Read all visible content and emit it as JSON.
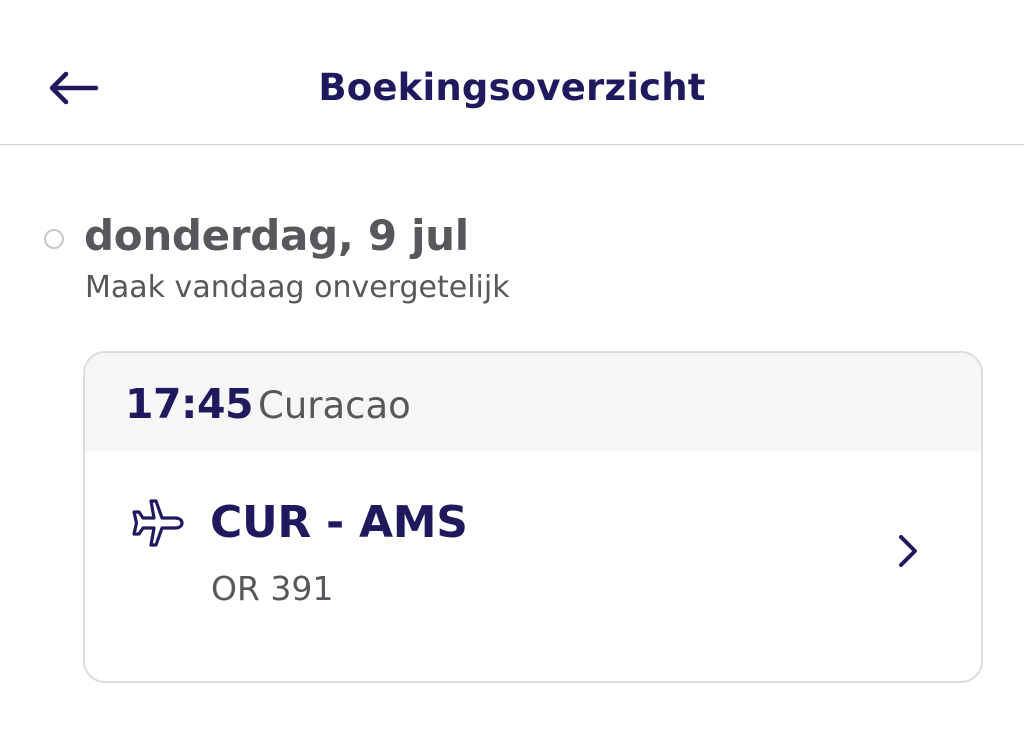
{
  "header": {
    "title": "Boekingsoverzicht",
    "back_icon": "arrow-left-icon"
  },
  "day": {
    "date": "donderdag, 9 jul",
    "subtitle": "Maak vandaag onvergetelijk"
  },
  "flight": {
    "time": "17:45",
    "city": "Curacao",
    "route": "CUR - AMS",
    "flight_number": "OR 391",
    "icon": "airplane-icon",
    "chevron_icon": "chevron-right-icon"
  },
  "colors": {
    "brand": "#1f1a5e",
    "text_secondary": "#58585c",
    "card_header_bg": "#f6f6f7",
    "border": "#dcdce0"
  }
}
